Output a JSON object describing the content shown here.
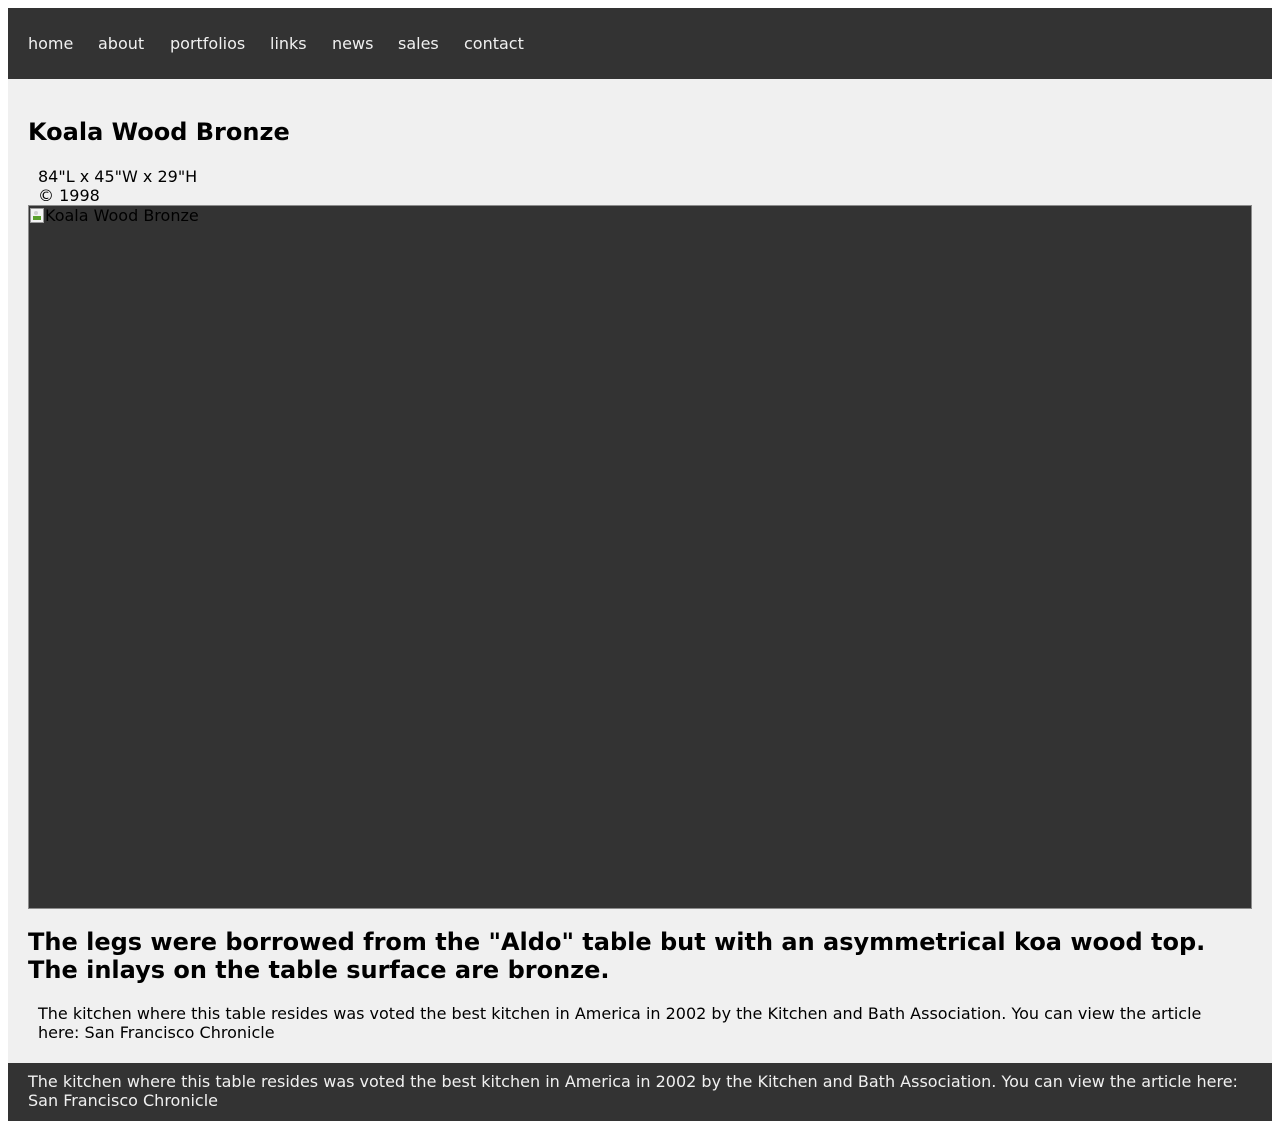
{
  "nav": {
    "items": [
      {
        "label": "home"
      },
      {
        "label": "about"
      },
      {
        "label": "portfolios"
      },
      {
        "label": "links"
      },
      {
        "label": "news"
      },
      {
        "label": "sales"
      },
      {
        "label": "contact"
      }
    ]
  },
  "artwork": {
    "title": "Koala Wood Bronze",
    "dimensions": "84\"L x 45\"W x 29\"H",
    "copyright": "© 1998",
    "image_alt": "Koala Wood Bronze",
    "image_icon": "broken-image-icon"
  },
  "description": {
    "headline": "The legs were borrowed from the \"Aldo\" table but with an asymmetrical koa wood top. The inlays on the table surface are bronze.",
    "body": "The kitchen where this table resides was voted the best kitchen in America in 2002 by the Kitchen and Bath Association. You can view the article here: San Francisco Chronicle"
  },
  "footer": {
    "text": "The kitchen where this table resides was voted the best kitchen in America in 2002 by the Kitchen and Bath Association. You can view the article here: San Francisco Chronicle"
  },
  "colors": {
    "nav_background": "#333333",
    "page_background": "#f0f0f0",
    "nav_text": "#f0f0f0"
  }
}
